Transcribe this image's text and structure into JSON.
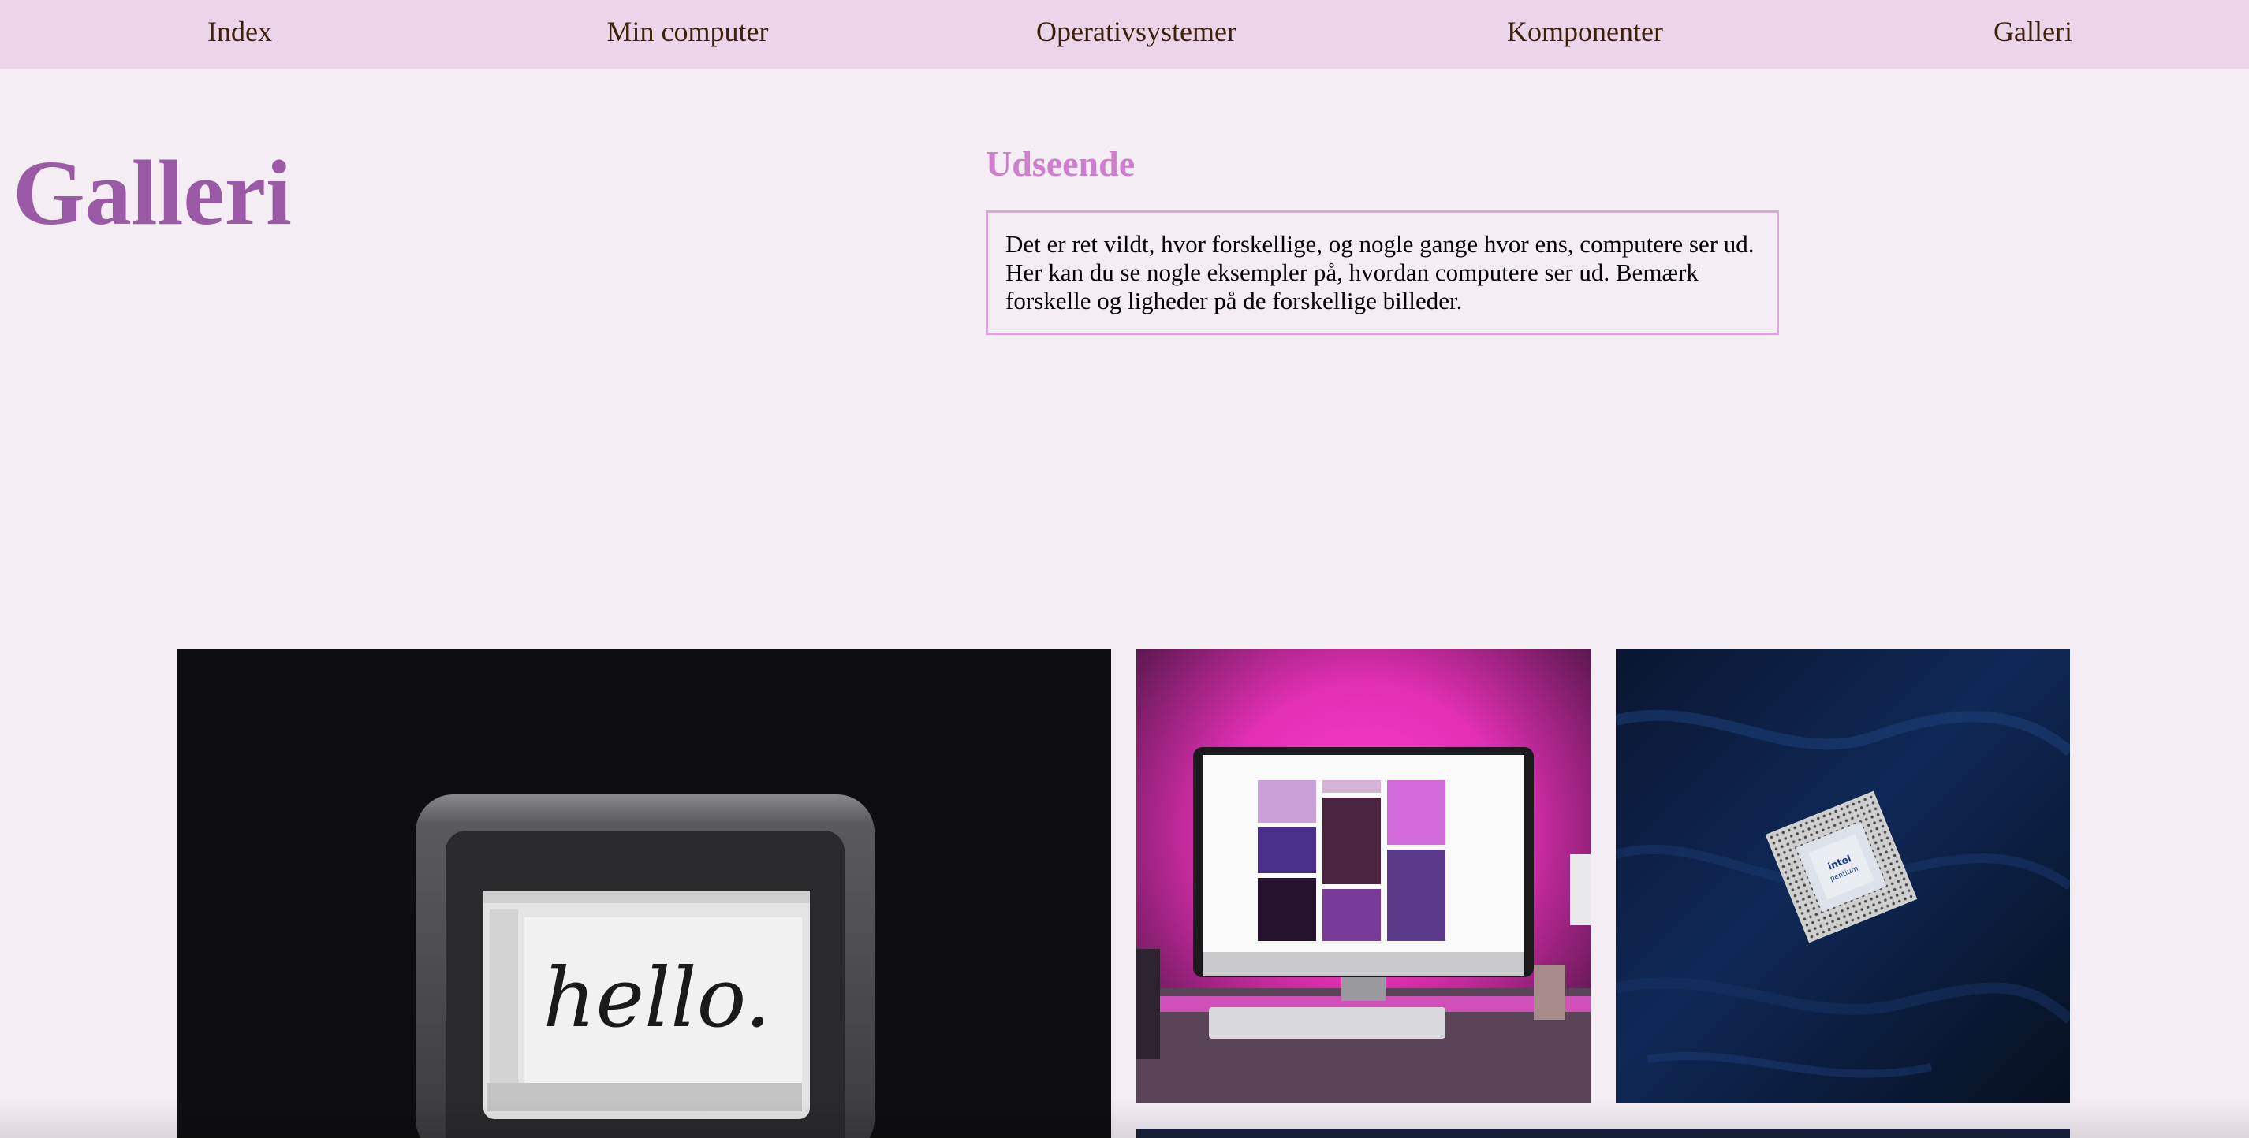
{
  "nav": {
    "items": [
      {
        "label": "Index"
      },
      {
        "label": "Min computer"
      },
      {
        "label": "Operativsystemer"
      },
      {
        "label": "Komponenter"
      },
      {
        "label": "Galleri"
      }
    ]
  },
  "page": {
    "title": "Galleri",
    "section_heading": "Udseende",
    "description": "Det er ret vildt, hvor forskellige, og nogle gange hvor ens, computere ser ud. Her kan du se nogle eksempler på, hvordan computere ser ud. Bemærk forskelle og ligheder på de forskellige billeder."
  },
  "gallery": {
    "images": [
      {
        "subject": "vintage macintosh computer",
        "screen_text": "hello."
      },
      {
        "subject": "imac desktop with pink lighting"
      },
      {
        "subject": "intel pentium processor on blue fabric",
        "chip_text": [
          "intel",
          "pentium"
        ]
      },
      {
        "subject": "partially visible dark blue photo"
      }
    ]
  },
  "colors": {
    "nav_background": "#ecd5e9",
    "page_background": "#f4eef4",
    "nav_text": "#3d1f0b",
    "title": "#9a5aa5",
    "section_heading": "#cf7ecf",
    "box_border": "#dca3df"
  }
}
